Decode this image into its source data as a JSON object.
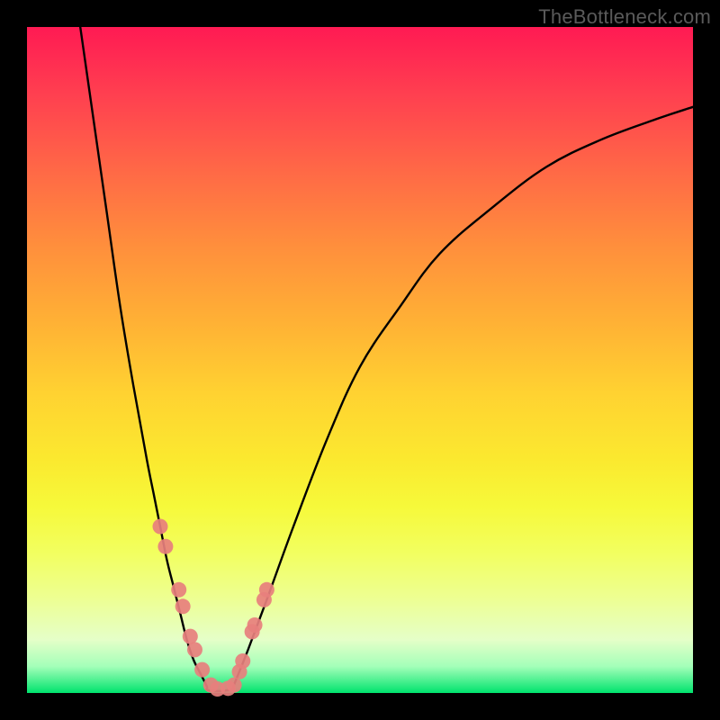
{
  "watermark": "TheBottleneck.com",
  "chart_data": {
    "type": "line",
    "title": "",
    "xlabel": "",
    "ylabel": "",
    "xlim": [
      0,
      100
    ],
    "ylim": [
      0,
      100
    ],
    "notes": "V-shaped bottleneck curve over a red-to-green vertical gradient. No numeric axes or tick labels are shown; values below are estimated pixel-normalized positions (0–100 each axis, y=0 at bottom).",
    "series": [
      {
        "name": "left-branch",
        "x": [
          8,
          10,
          12,
          14,
          16,
          18,
          19,
          20,
          21,
          22,
          23,
          24,
          25,
          26,
          27
        ],
        "y": [
          100,
          86,
          72,
          58,
          46,
          35,
          30,
          25,
          20,
          16,
          12,
          8,
          5,
          3,
          1
        ]
      },
      {
        "name": "valley-floor",
        "x": [
          27,
          28,
          29,
          30,
          31
        ],
        "y": [
          0.5,
          0.3,
          0.3,
          0.4,
          0.6
        ]
      },
      {
        "name": "right-branch",
        "x": [
          31,
          33,
          36,
          40,
          45,
          50,
          56,
          62,
          70,
          78,
          86,
          94,
          100
        ],
        "y": [
          1,
          6,
          14,
          25,
          38,
          49,
          58,
          66,
          73,
          79,
          83,
          86,
          88
        ]
      },
      {
        "name": "highlighted-points",
        "style": "pink-dots",
        "x": [
          20.0,
          20.8,
          22.8,
          23.4,
          24.5,
          25.2,
          26.3,
          27.6,
          28.6,
          30.2,
          31.1,
          31.9,
          32.4,
          33.8,
          34.2,
          35.6,
          36.0
        ],
        "y": [
          25,
          22,
          15.5,
          13,
          8.5,
          6.5,
          3.5,
          1.2,
          0.6,
          0.7,
          1.2,
          3.2,
          4.8,
          9.2,
          10.2,
          14.0,
          15.5
        ]
      }
    ],
    "gradient_stops": [
      {
        "pos": 0.0,
        "color": "#ff1a53"
      },
      {
        "pos": 0.55,
        "color": "#ffd231"
      },
      {
        "pos": 0.96,
        "color": "#a4ffb9"
      },
      {
        "pos": 1.0,
        "color": "#00e36d"
      }
    ]
  }
}
